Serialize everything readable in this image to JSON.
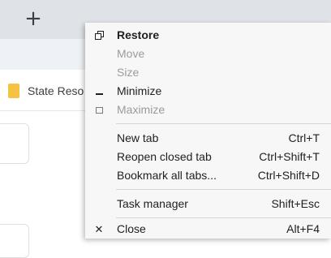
{
  "tabstrip": {
    "new_tab_icon": "plus-icon",
    "new_tab_label": "+"
  },
  "bookmarks": [
    {
      "label": "State Reso",
      "icon": "folder-icon"
    }
  ],
  "menu": {
    "items": [
      {
        "label": "Restore",
        "icon": "restore-icon",
        "disabled": false,
        "bold": true
      },
      {
        "label": "Move",
        "disabled": true
      },
      {
        "label": "Size",
        "disabled": true
      },
      {
        "label": "Minimize",
        "icon": "minimize-icon",
        "disabled": false
      },
      {
        "label": "Maximize",
        "icon": "maximize-icon",
        "disabled": true
      },
      {
        "label": "New tab",
        "shortcut": "Ctrl+T"
      },
      {
        "label": "Reopen closed tab",
        "shortcut": "Ctrl+Shift+T"
      },
      {
        "label": "Bookmark all tabs...",
        "shortcut": "Ctrl+Shift+D"
      },
      {
        "label": "Task manager",
        "shortcut": "Shift+Esc"
      },
      {
        "label": "Close",
        "icon": "close-icon",
        "icon_glyph": "✕",
        "shortcut": "Alt+F4"
      }
    ]
  }
}
